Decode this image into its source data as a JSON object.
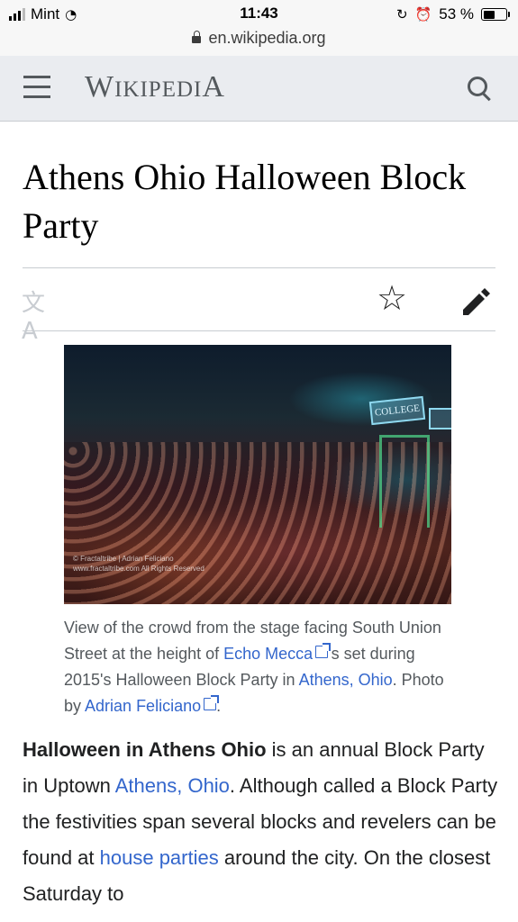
{
  "status_bar": {
    "carrier": "Mint",
    "time": "11:43",
    "battery_pct": "53 %",
    "battery_level": 0.53,
    "url": "en.wikipedia.org"
  },
  "header": {
    "logo_first": "W",
    "logo_rest": "IKIPEDI",
    "logo_last": "A",
    "icons": [
      "hamburger-menu-icon",
      "search-icon"
    ]
  },
  "article": {
    "title": "Athens Ohio Halloween Block Party",
    "icons": [
      "language-icon",
      "star-icon",
      "edit-pencil-icon"
    ],
    "image_watermark": "© Fractaltribe | Adrian Feliciano www.fractaltribe.com All Rights Reserved",
    "image_signs": [
      "COLLEGE"
    ],
    "caption": {
      "t1": "View of the crowd from the stage facing South Union Street at the height of ",
      "l1": "Echo Mecca",
      "t2": "'s set during 2015's Halloween Block Party in ",
      "l2": "Athens, Ohio",
      "t3": ". Photo by ",
      "l3": "Adrian Feliciano",
      "t4": "."
    },
    "paragraph": {
      "bold": "Halloween in Athens Ohio",
      "t1": " is an annual Block Party in Uptown ",
      "l1": "Athens, Ohio",
      "t2": ". Although called a Block Party the festivities span several blocks and revelers can be found at ",
      "l2": "house parties",
      "t3": " around the city. On the closest Saturday to"
    }
  },
  "colors": {
    "link": "#3366cc",
    "header_bg": "#eaecf0",
    "text": "#202122",
    "caption": "#54595d"
  }
}
